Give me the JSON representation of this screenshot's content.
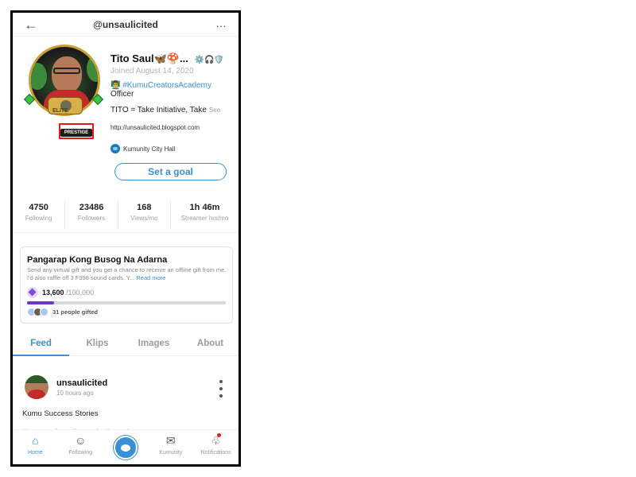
{
  "header": {
    "back_icon": "arrow-left-icon",
    "handle": "@unsaulicited",
    "more_label": "…"
  },
  "avatar": {
    "elite_text": "ELITE",
    "prestige_text": "PRESTIGE"
  },
  "profile": {
    "name": "Tito Saul",
    "name_suffix": "🦋🍄...",
    "badge_icons": "⚙️🎧🛡️",
    "joined": "Joined August 14, 2020",
    "academy_emoji": "👨‍🏫",
    "academy_tag": "#KumuCreatorsAcademy",
    "role": "Officer",
    "bio": "TITO = Take Initiative, Take",
    "see_more": "See",
    "link": "http://unsaulicited.blogspot.com",
    "community": "Kumunity City Hall",
    "goal_button": "Set a goal"
  },
  "stats": [
    {
      "value": "4750",
      "label": "Following"
    },
    {
      "value": "23486",
      "label": "Followers"
    },
    {
      "value": "168",
      "label": "Views/mo"
    },
    {
      "value": "1h 46m",
      "label": "Streamer hrs/mo"
    }
  ],
  "goal": {
    "title": "Pangarap Kong Busog Na Adarna",
    "description": "Send any virtual gift and you get a chance to receive an offline gift from me. I'd also raffle off 3 F998 sound cards. Y...",
    "read_more": "Read more",
    "current": "13,600",
    "target": "/100,000",
    "progress_fraction": 0.136,
    "gifted": "31 people gifted"
  },
  "tabs": [
    {
      "label": "Feed",
      "active": true
    },
    {
      "label": "Klips",
      "active": false
    },
    {
      "label": "Images",
      "active": false
    },
    {
      "label": "About",
      "active": false
    }
  ],
  "post": {
    "user": "unsaulicited",
    "time": "10 hours ago",
    "text": "Kumu Success Stories",
    "tags": "#myrecordings #kumunitychannel"
  },
  "nav": [
    {
      "label": "Home",
      "icon": "home-icon"
    },
    {
      "label": "Following",
      "icon": "people-icon"
    },
    {
      "label": "",
      "icon": "kumu-logo-icon"
    },
    {
      "label": "Kumunity",
      "icon": "chat-icon"
    },
    {
      "label": "Notifications",
      "icon": "bell-icon"
    }
  ],
  "colors": {
    "accent": "#3b8fd6",
    "progress": "#6b38c8",
    "highlight_box": "#e01a1a"
  }
}
